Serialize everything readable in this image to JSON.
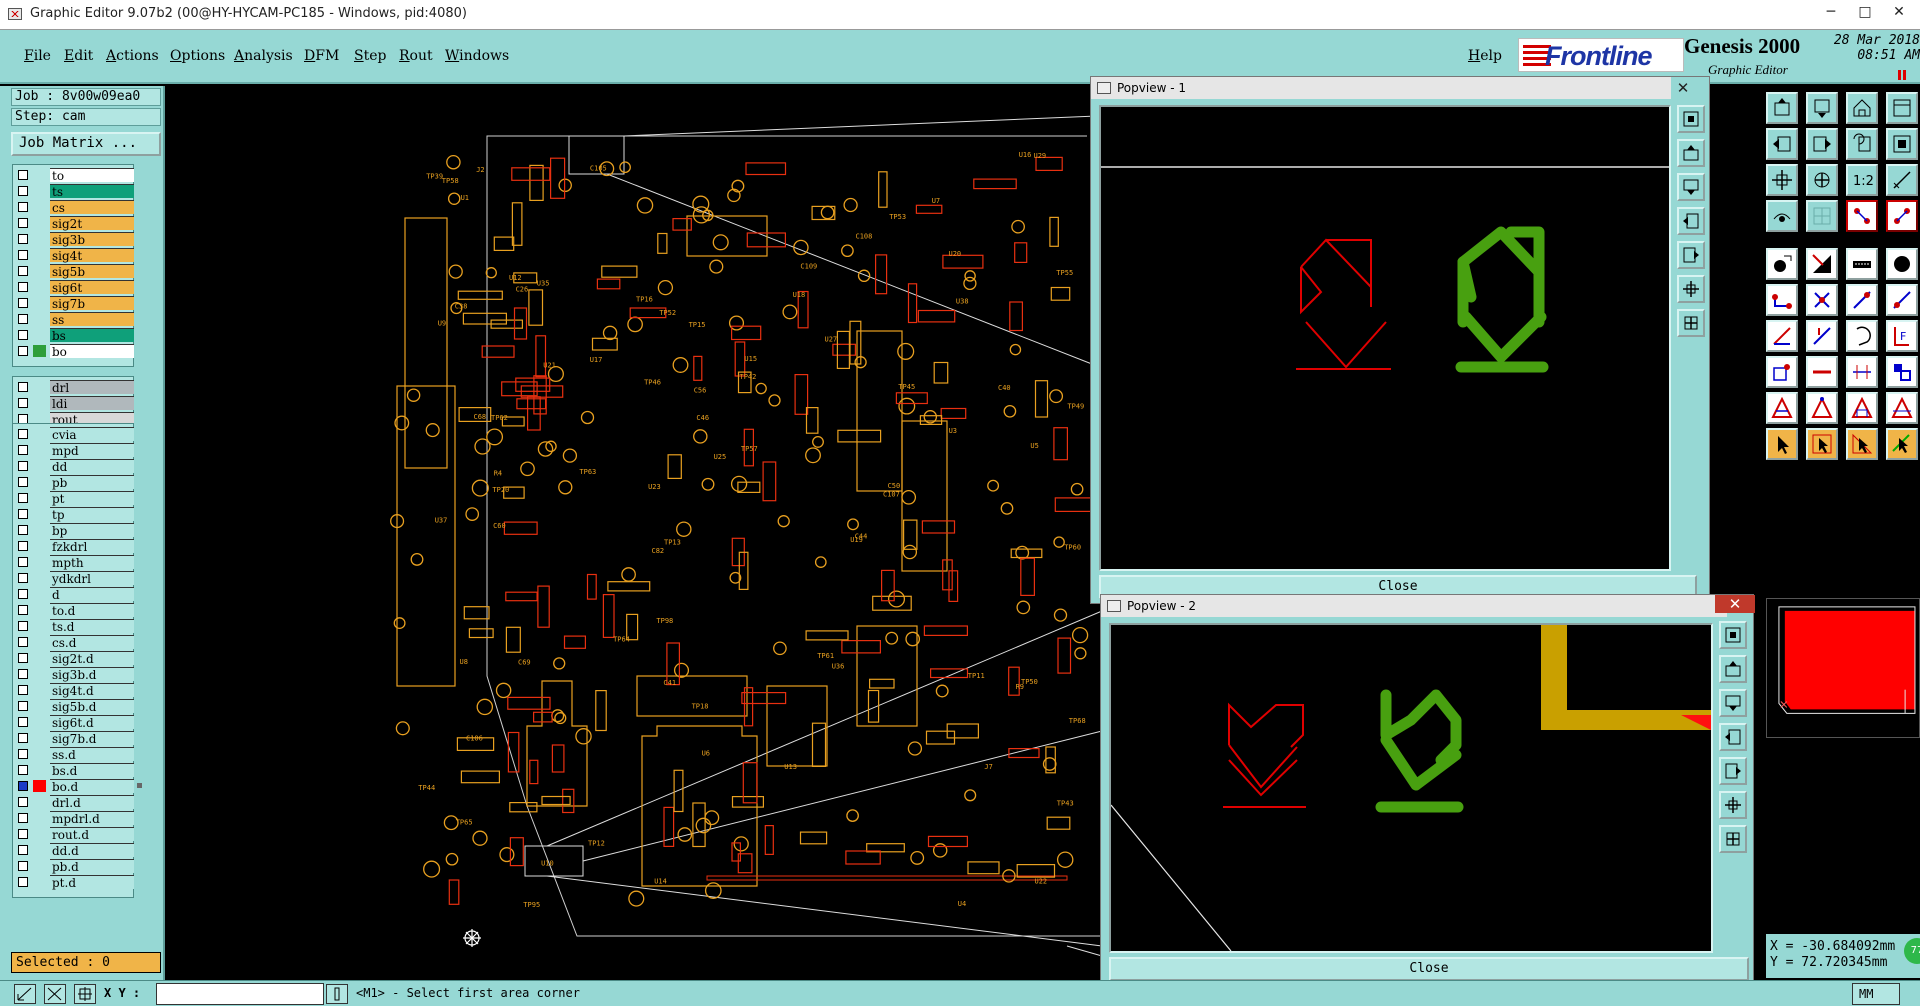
{
  "window": {
    "title": "Graphic Editor 9.07b2 (00@HY-HYCAM-PC185 - Windows, pid:4080)",
    "min": "─",
    "max": "□",
    "close": "✕"
  },
  "menu": [
    "File",
    "Edit",
    "Actions",
    "Options",
    "Analysis",
    "DFM",
    "Step",
    "Rout",
    "Windows"
  ],
  "help": "Help",
  "brand": {
    "logo": "Frontline",
    "product": "Genesis 2000",
    "subtitle": "Graphic Editor",
    "date": "28 Mar 2018",
    "time": "08:51 AM"
  },
  "job": {
    "job_line": "Job : 8v00w09ea0",
    "step_line": "Step: cam",
    "matrix_button": "Job Matrix ..."
  },
  "colors": {
    "teal": "#96d8d4",
    "ts_green": "#0fa07a",
    "signal_orange": "#f0b448",
    "drill_gray": "#b0b8bc",
    "white": "#ffffff",
    "red": "#ff0000"
  },
  "layers": {
    "group1": [
      {
        "name": "to",
        "color": "#ffffff"
      },
      {
        "name": "ts",
        "color": "#0fa07a"
      },
      {
        "name": "cs",
        "color": "#f0b448"
      },
      {
        "name": "sig2t",
        "color": "#f0b448"
      },
      {
        "name": "sig3b",
        "color": "#f0b448"
      },
      {
        "name": "sig4t",
        "color": "#f0b448"
      },
      {
        "name": "sig5b",
        "color": "#f0b448"
      },
      {
        "name": "sig6t",
        "color": "#f0b448"
      },
      {
        "name": "sig7b",
        "color": "#f0b448"
      },
      {
        "name": "ss",
        "color": "#f0b448"
      },
      {
        "name": "bs",
        "color": "#0fa07a"
      },
      {
        "name": "bo",
        "color": "#ffffff",
        "indicator": "#2e9e3a"
      }
    ],
    "group2": [
      {
        "name": "drl",
        "color": "#b0b8bc"
      },
      {
        "name": "ldi",
        "color": "#b0b8bc"
      },
      {
        "name": "rout",
        "color": "#d8d8d8"
      }
    ],
    "group3": [
      {
        "name": "cvia"
      },
      {
        "name": "mpd"
      },
      {
        "name": "dd"
      },
      {
        "name": "pb"
      },
      {
        "name": "pt"
      },
      {
        "name": "tp"
      },
      {
        "name": "bp"
      },
      {
        "name": "fzkdrl"
      },
      {
        "name": "mpth"
      },
      {
        "name": "ydkdrl"
      },
      {
        "name": "d"
      },
      {
        "name": "to.d"
      },
      {
        "name": "ts.d"
      },
      {
        "name": "cs.d"
      },
      {
        "name": "sig2t.d"
      },
      {
        "name": "sig3b.d"
      },
      {
        "name": "sig4t.d"
      },
      {
        "name": "sig5b.d"
      },
      {
        "name": "sig6t.d"
      },
      {
        "name": "sig7b.d"
      },
      {
        "name": "ss.d"
      },
      {
        "name": "bs.d"
      },
      {
        "name": "bo.d",
        "active": true,
        "indicator": "#ff0000"
      },
      {
        "name": "drl.d"
      },
      {
        "name": "mpdrl.d"
      },
      {
        "name": "rout.d"
      },
      {
        "name": "dd.d"
      },
      {
        "name": "pb.d"
      },
      {
        "name": "pt.d"
      }
    ]
  },
  "status": {
    "selected": "Selected : 0"
  },
  "bottom": {
    "xy_label": "X Y :",
    "xy_value": "",
    "prompt": "<M1> - Select first area corner",
    "units": "MM"
  },
  "coords": {
    "x": "X = -30.684092mm",
    "y": "Y = 72.720345mm"
  },
  "green_badge": "77",
  "popview1": {
    "title": "Popview - 1",
    "close_button": "Close",
    "x_glyph": "✕"
  },
  "popview2": {
    "title": "Popview - 2",
    "close_button": "Close",
    "x_glyph": "✕"
  },
  "pcb_labels": [
    "TP58",
    "TP60",
    "TP52",
    "TP63",
    "TP64",
    "TP61",
    "TP62",
    "TP53",
    "TP65",
    "TP55",
    "U18",
    "C38",
    "C26",
    "U21",
    "U22",
    "TP68",
    "TP50",
    "U37",
    "U38",
    "C106",
    "C108",
    "TP43",
    "TP44",
    "U35",
    "U7",
    "U9",
    "U16",
    "C109",
    "U15",
    "U10",
    "C107",
    "TP45",
    "TP46",
    "TP42",
    "U8",
    "C50",
    "C105",
    "TP11",
    "U36",
    "U14",
    "C41",
    "C46",
    "TP20",
    "TP39",
    "U6",
    "J7",
    "J2",
    "TP49",
    "U5",
    "U29",
    "C56",
    "U19",
    "C40",
    "U1",
    "TP13",
    "U17",
    "TP12",
    "TP18",
    "TP15",
    "TP16",
    "C60",
    "C44",
    "U27",
    "U20",
    "U23",
    "U25",
    "U4",
    "U3",
    "TP95",
    "TP57",
    "TP98",
    "C68",
    "C69",
    "C82",
    "U13",
    "U12",
    "R4",
    "R9"
  ]
}
